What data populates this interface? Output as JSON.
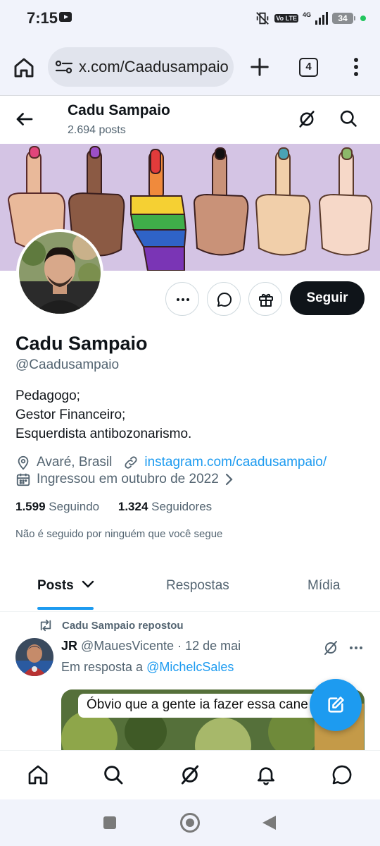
{
  "status_bar": {
    "time": "7:15",
    "network_badge": "Vo LTE",
    "network_type": "4G",
    "battery": "34"
  },
  "browser": {
    "url": "x.com/Caadusampaio",
    "tab_count": "4"
  },
  "header": {
    "name": "Cadu Sampaio",
    "post_count": "2.694 posts"
  },
  "profile": {
    "follow_label": "Seguir",
    "display_name": "Cadu Sampaio",
    "handle": "@Caadusampaio",
    "bio_lines": [
      "Pedagogo;",
      "Gestor Financeiro;",
      "Esquerdista antibozonarismo."
    ],
    "location": "Avaré, Brasil",
    "website": "instagram.com/caadusampaio/",
    "joined": "Ingressou em outubro de 2022",
    "following_count": "1.599",
    "following_label": "Seguindo",
    "followers_count": "1.324",
    "followers_label": "Seguidores",
    "followed_by_note": "Não é seguido por ninguém que você segue"
  },
  "tabs": [
    {
      "label": "Posts",
      "active": true
    },
    {
      "label": "Respostas",
      "active": false
    },
    {
      "label": "Mídia",
      "active": false
    }
  ],
  "post": {
    "repost_label": "Cadu Sampaio repostou",
    "author": "JR",
    "handle": "@MauesVicente",
    "separator": "·",
    "date": "12 de mai",
    "reply_prefix": "Em resposta a",
    "reply_mention": "@MichelcSales",
    "media_caption": "Óbvio que a gente ia fazer essa cane"
  },
  "colors": {
    "accent": "#1d9bf0",
    "text_primary": "#0f1419",
    "text_secondary": "#536471",
    "banner_bg": "#d4c4e4"
  }
}
